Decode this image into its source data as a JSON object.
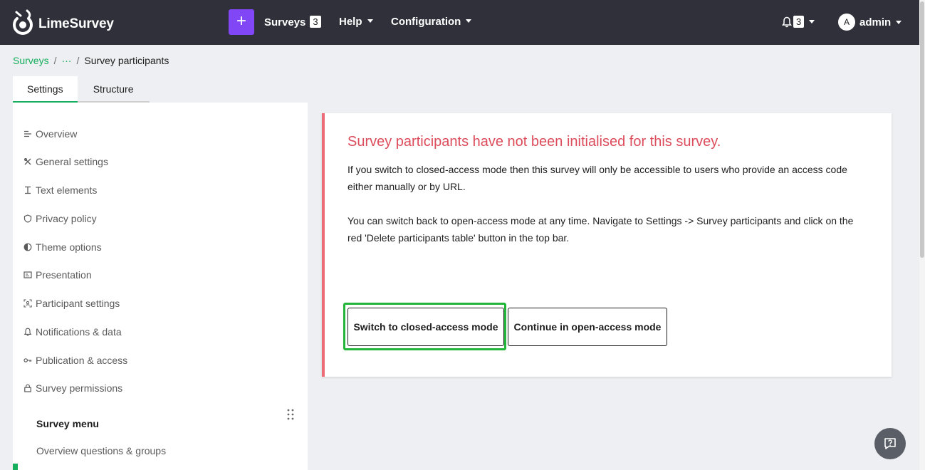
{
  "app": {
    "name": "LimeSurvey"
  },
  "navbar": {
    "create_label": "+",
    "surveys_label": "Surveys",
    "surveys_count": "3",
    "help_label": "Help",
    "configuration_label": "Configuration",
    "notifications_count": "3",
    "user_initial": "A",
    "user_name": "admin"
  },
  "breadcrumb": {
    "root": "Surveys",
    "separator": "/",
    "ellipsis": "···",
    "current": "Survey participants"
  },
  "tabs": [
    {
      "label": "Settings",
      "active": true
    },
    {
      "label": "Structure",
      "active": false
    }
  ],
  "sidebar": {
    "items": [
      {
        "label": "Overview",
        "icon": "list-icon"
      },
      {
        "label": "General settings",
        "icon": "tools-icon"
      },
      {
        "label": "Text elements",
        "icon": "text-cursor-icon"
      },
      {
        "label": "Privacy policy",
        "icon": "shield-icon"
      },
      {
        "label": "Theme options",
        "icon": "contrast-icon"
      },
      {
        "label": "Presentation",
        "icon": "presentation-icon"
      },
      {
        "label": "Participant settings",
        "icon": "participants-icon"
      },
      {
        "label": "Notifications & data",
        "icon": "bell-icon"
      },
      {
        "label": "Publication & access",
        "icon": "key-icon"
      },
      {
        "label": "Survey permissions",
        "icon": "lock-icon"
      }
    ],
    "menu_title": "Survey menu",
    "sub_link": "Overview questions & groups"
  },
  "alert": {
    "title": "Survey participants have not been initialised for this survey.",
    "paragraph1": "If you switch to closed-access mode then this survey will only be accessible to users who provide an access code either manually or by URL.",
    "paragraph2": "You can switch back to open-access mode at any time. Navigate to Settings -> Survey participants and click on the red 'Delete participants table' button in the top bar.",
    "button_closed": "Switch to closed-access mode",
    "button_open": "Continue in open-access mode"
  },
  "colors": {
    "navbar_bg": "#2f3039",
    "accent_purple": "#8146f6",
    "brand_green": "#14ae5c",
    "alert_red": "#dd4c5b",
    "highlight_green": "#22b53a"
  }
}
